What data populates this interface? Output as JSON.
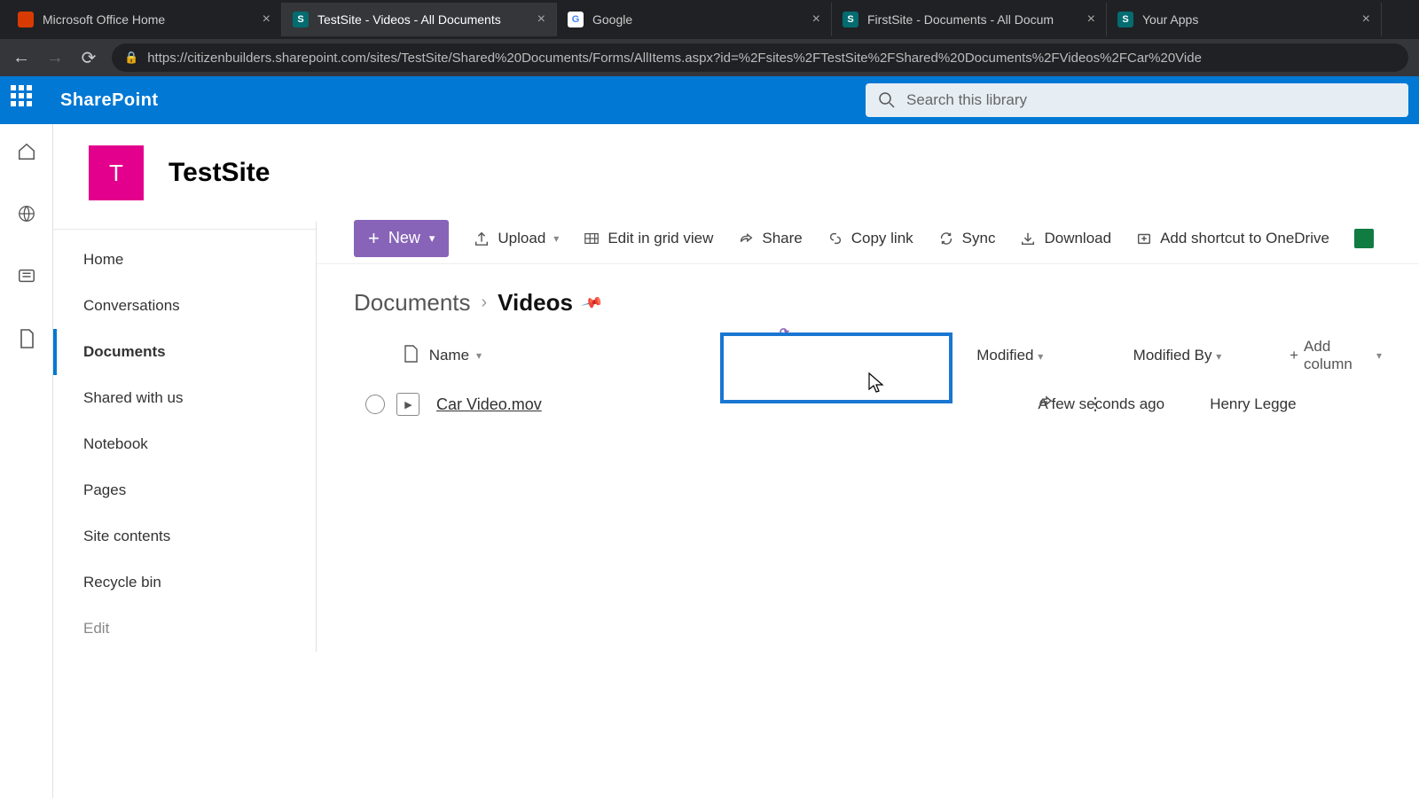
{
  "browser": {
    "tabs": [
      {
        "title": "Microsoft Office Home",
        "color": "#d83b01",
        "letter": ""
      },
      {
        "title": "TestSite - Videos - All Documents",
        "color": "#036c70",
        "letter": "S",
        "active": true
      },
      {
        "title": "Google",
        "color": "#fff",
        "letter": "G"
      },
      {
        "title": "FirstSite - Documents - All Docum",
        "color": "#036c70",
        "letter": "S"
      },
      {
        "title": "Your Apps",
        "color": "#036c70",
        "letter": "S"
      }
    ],
    "url": "https://citizenbuilders.sharepoint.com/sites/TestSite/Shared%20Documents/Forms/AllItems.aspx?id=%2Fsites%2FTestSite%2FShared%20Documents%2FVideos%2FCar%20Vide"
  },
  "sharepoint": {
    "brand": "SharePoint",
    "search_placeholder": "Search this library"
  },
  "site": {
    "logo_letter": "T",
    "title": "TestSite"
  },
  "nav": {
    "items": [
      "Home",
      "Conversations",
      "Documents",
      "Shared with us",
      "Notebook",
      "Pages",
      "Site contents",
      "Recycle bin"
    ],
    "edit": "Edit",
    "selected_index": 2
  },
  "commands": {
    "new_label": "New",
    "upload": "Upload",
    "edit_grid": "Edit in grid view",
    "share": "Share",
    "copy_link": "Copy link",
    "sync": "Sync",
    "download": "Download",
    "add_shortcut": "Add shortcut to OneDrive"
  },
  "breadcrumb": {
    "root": "Documents",
    "current": "Videos"
  },
  "columns": {
    "name": "Name",
    "modified": "Modified",
    "modified_by": "Modified By",
    "add": "Add column"
  },
  "files": [
    {
      "name": "Car Video.mov",
      "modified": "A few seconds ago",
      "modified_by": "Henry Legge"
    }
  ]
}
